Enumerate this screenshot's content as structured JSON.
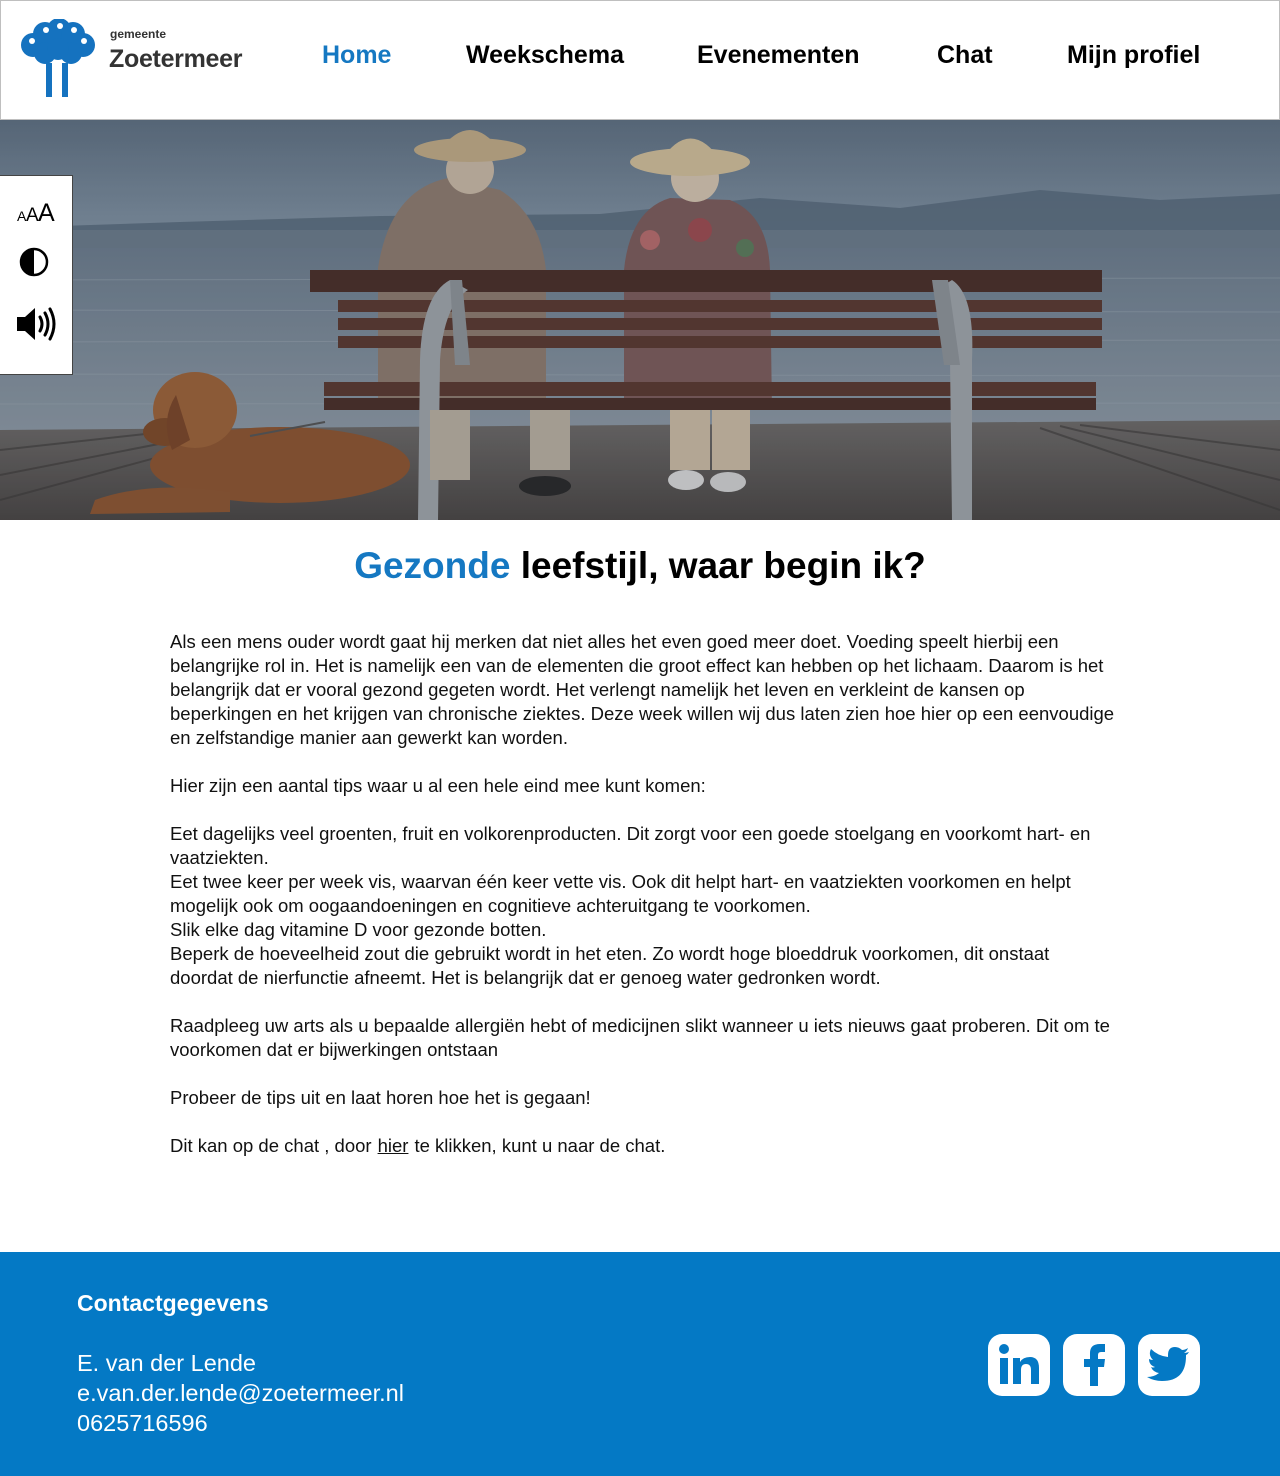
{
  "brand": {
    "small": "gemeente",
    "name": "Zoetermeer"
  },
  "nav": [
    {
      "label": "Home",
      "active": true
    },
    {
      "label": "Weekschema",
      "active": false
    },
    {
      "label": "Evenementen",
      "active": false
    },
    {
      "label": "Chat",
      "active": false
    },
    {
      "label": "Mijn profiel",
      "active": false
    }
  ],
  "accessibility": {
    "text_size_icon": "text-size-icon",
    "contrast_icon": "contrast-icon",
    "speaker_icon": "speaker-icon"
  },
  "hero": {
    "image": "elderly couple sitting on bench by the sea with dog"
  },
  "article": {
    "title_accent": "Gezonde",
    "title_rest": "leefstijl, waar begin ik?",
    "intro": "Als een mens ouder wordt gaat hij merken dat niet alles het even goed meer doet. Voeding speelt hierbij een belangrijke rol in. Het is namelijk een van de elementen die groot effect kan hebben op het lichaam. Daarom is het belangrijk dat er vooral gezond gegeten wordt. Het verlengt namelijk het leven en verkleint de kansen op beperkingen en het krijgen van chronische ziektes. Deze week willen wij dus laten zien hoe hier op een eenvoudige en zelfstandige manier aan gewerkt kan worden.",
    "tips_intro": "Hier zijn een aantal tips waar u al een hele eind mee kunt komen:",
    "tips": [
      "Eet dagelijks veel groenten, fruit en volkorenproducten. Dit zorgt voor een goede stoelgang en voorkomt hart- en vaatziekten.",
      "Eet twee keer per week vis, waarvan één keer vette vis. Ook dit helpt hart- en vaatziekten voorkomen en helpt mogelijk ook om oogaandoeningen en cognitieve achteruitgang te voorkomen.",
      "Slik elke dag vitamine D voor gezonde botten.",
      "Beperk de hoeveelheid zout die gebruikt wordt in het eten. Zo wordt hoge bloeddruk voorkomen, dit onstaat doordat de nierfunctie afneemt. Het is belangrijk dat er genoeg water gedronken wordt."
    ],
    "advice": "Raadpleeg uw arts als u bepaalde allergiën hebt of medicijnen slikt wanneer u iets nieuws gaat proberen. Dit om te voorkomen dat er bijwerkingen ontstaan",
    "try": "Probeer de tips uit en laat horen hoe het is gegaan!",
    "chat_before": "Dit kan op de chat , door",
    "chat_link": "hier",
    "chat_after": "te klikken, kunt u naar de chat."
  },
  "footer": {
    "heading": "Contactgegevens",
    "name": "E. van der Lende",
    "email": "e.van.der.lende@zoetermeer.nl",
    "phone": "0625716596",
    "social": [
      "linkedin-icon",
      "facebook-icon",
      "twitter-icon"
    ]
  },
  "colors": {
    "accent": "#1578c2",
    "footer": "#0479c5"
  }
}
